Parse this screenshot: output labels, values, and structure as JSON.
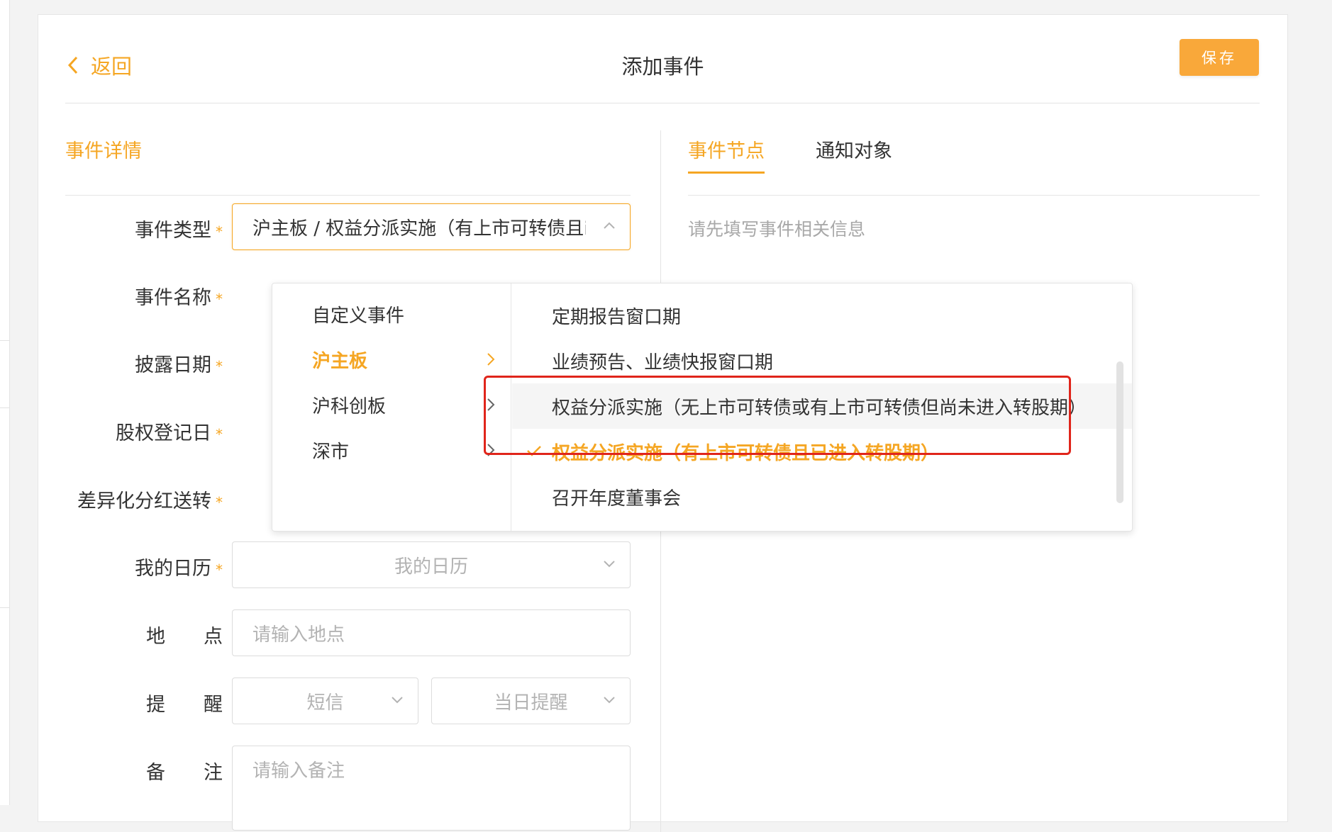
{
  "header": {
    "back_label": "返回",
    "title": "添加事件",
    "save_label": "保存"
  },
  "left_section": {
    "title": "事件详情"
  },
  "right_section": {
    "tabs": [
      "事件节点",
      "通知对象"
    ],
    "active_tab": "事件节点",
    "hint": "请先填写事件相关信息"
  },
  "form": {
    "event_type": {
      "label": "事件类型",
      "value": "沪主板 / 权益分派实施（有上市可转债且i"
    },
    "event_name": {
      "label": "事件名称"
    },
    "disclosure_date": {
      "label": "披露日期"
    },
    "equity_reg_date": {
      "label": "股权登记日"
    },
    "diff_dividend": {
      "label": "差异化分红送转"
    },
    "calendar": {
      "label": "我的日历",
      "value": "我的日历"
    },
    "location": {
      "label": "地　　点",
      "placeholder": "请输入地点"
    },
    "reminder": {
      "label": "提　　醒",
      "channel": "短信",
      "timing": "当日提醒"
    },
    "remarks": {
      "label": "备　　注",
      "placeholder": "请输入备注"
    }
  },
  "dropdown": {
    "categories": [
      {
        "label": "自定义事件"
      },
      {
        "label": "沪主板",
        "selected": true
      },
      {
        "label": "沪科创板"
      },
      {
        "label": "深市"
      }
    ],
    "options": [
      {
        "label": "定期报告窗口期"
      },
      {
        "label": "业绩预告、业绩快报窗口期"
      },
      {
        "label": "权益分派实施（无上市可转债或有上市可转债但尚未进入转股期）",
        "hover": true
      },
      {
        "label": "权益分派实施（有上市可转债且已进入转股期）",
        "selected": true
      },
      {
        "label": "召开年度董事会"
      }
    ]
  },
  "colors": {
    "accent": "#f5a623",
    "save_button": "#f9a83a",
    "highlight_box": "#e0251b"
  }
}
